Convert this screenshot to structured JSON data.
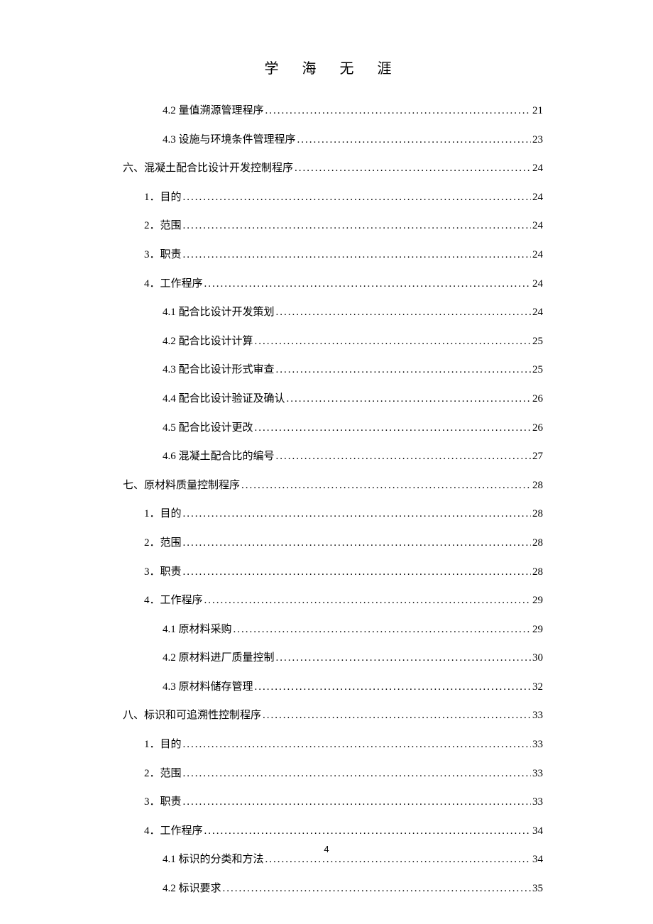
{
  "header": "学 海 无 涯",
  "footer": "4",
  "toc": [
    {
      "level": 2,
      "label": "4.2 量值溯源管理程序",
      "page": "21"
    },
    {
      "level": 2,
      "label": "4.3 设施与环境条件管理程序",
      "page": "23"
    },
    {
      "level": 0,
      "label": "六、混凝土配合比设计开发控制程序",
      "page": "24"
    },
    {
      "level": 1,
      "label": "1．目的",
      "page": "24"
    },
    {
      "level": 1,
      "label": "2．范围",
      "page": "24"
    },
    {
      "level": 1,
      "label": "3．职责",
      "page": "24"
    },
    {
      "level": 1,
      "label": "4．工作程序",
      "page": "24"
    },
    {
      "level": 2,
      "label": "4.1 配合比设计开发策划",
      "page": "24"
    },
    {
      "level": 2,
      "label": "4.2 配合比设计计算",
      "page": "25"
    },
    {
      "level": 2,
      "label": "4.3 配合比设计形式审查",
      "page": "25"
    },
    {
      "level": 2,
      "label": "4.4 配合比设计验证及确认",
      "page": "26"
    },
    {
      "level": 2,
      "label": "4.5 配合比设计更改",
      "page": "26"
    },
    {
      "level": 2,
      "label": "4.6 混凝土配合比的编号",
      "page": "27"
    },
    {
      "level": 0,
      "label": "七、原材料质量控制程序",
      "page": "28"
    },
    {
      "level": 1,
      "label": "1．目的",
      "page": "28"
    },
    {
      "level": 1,
      "label": "2．范围",
      "page": "28"
    },
    {
      "level": 1,
      "label": "3．职责",
      "page": "28"
    },
    {
      "level": 1,
      "label": "4．工作程序",
      "page": "29"
    },
    {
      "level": 2,
      "label": "4.1 原材料采购",
      "page": "29"
    },
    {
      "level": 2,
      "label": "4.2 原材料进厂质量控制",
      "page": "30"
    },
    {
      "level": 2,
      "label": "4.3 原材料储存管理",
      "page": "32"
    },
    {
      "level": 0,
      "label": "八、标识和可追溯性控制程序",
      "page": "33"
    },
    {
      "level": 1,
      "label": "1．目的",
      "page": "33"
    },
    {
      "level": 1,
      "label": "2．范围",
      "page": "33"
    },
    {
      "level": 1,
      "label": "3．职责",
      "page": "33"
    },
    {
      "level": 1,
      "label": "4．工作程序",
      "page": "34"
    },
    {
      "level": 2,
      "label": "4.1 标识的分类和方法",
      "page": "34"
    },
    {
      "level": 2,
      "label": "4.2 标识要求",
      "page": "35"
    }
  ]
}
